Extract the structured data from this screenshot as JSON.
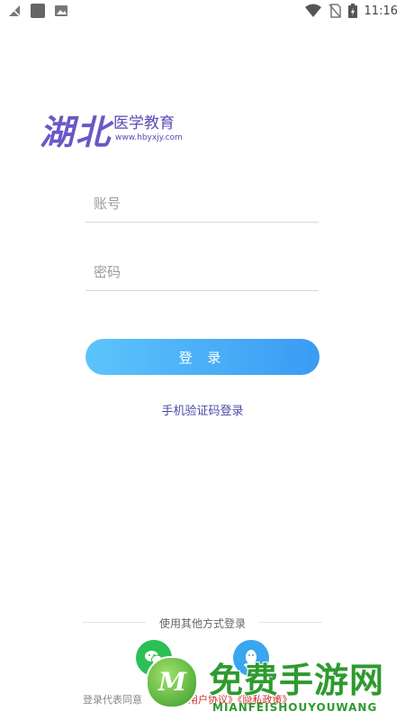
{
  "status_bar": {
    "time": "11:16",
    "icons_left": [
      "signal-off-icon",
      "app-square-icon",
      "image-icon"
    ],
    "icons_right": [
      "wifi-icon",
      "no-sim-icon",
      "battery-charging-icon"
    ]
  },
  "logo": {
    "script_text": "湖北",
    "title": "医学教育",
    "url": "www.hbyxjy.com"
  },
  "form": {
    "account_placeholder": "账号",
    "password_placeholder": "密码",
    "login_label": "登 录",
    "sms_login": "手机验证码登录"
  },
  "other_login": {
    "label": "使用其他方式登录",
    "providers": [
      "wechat-icon",
      "qq-icon"
    ]
  },
  "terms": {
    "prefix": "登录代表同意",
    "user_agreement": "《用户协议》",
    "privacy_policy": "《隐私政策》"
  },
  "watermark": {
    "cn": "免费手游网",
    "en": "MIANFEISHOUYOUWANG",
    "logo_letter": "M"
  },
  "colors": {
    "primary_gradient_start": "#5cc4fb",
    "primary_gradient_end": "#3a9bf4",
    "logo": "#6a58c6",
    "link": "#4a4aa8",
    "agreement": "#cc2a2a"
  }
}
